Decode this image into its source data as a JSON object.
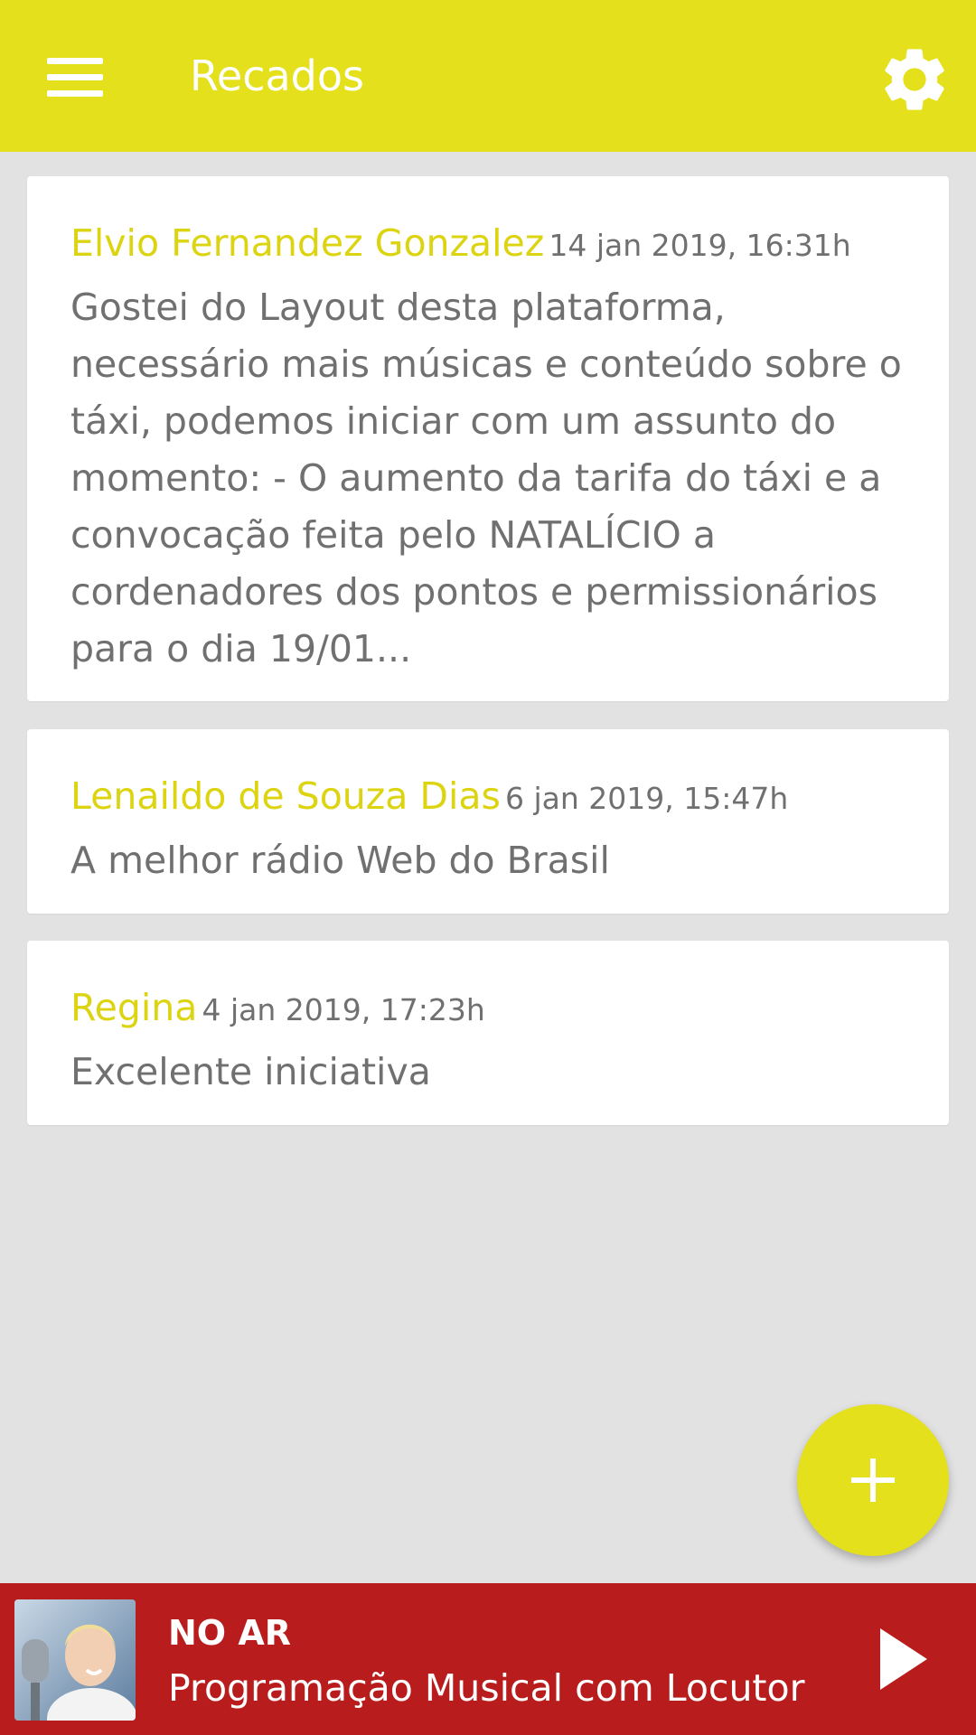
{
  "appbar": {
    "title": "Recados",
    "menu_icon": "menu-icon",
    "settings_icon": "gear-icon",
    "background": "#e4e01b"
  },
  "messages": [
    {
      "author": "Elvio Fernandez Gonzalez",
      "date": "14 jan 2019, 16:31h",
      "text": "Gostei do Layout desta plataforma, necessário mais músicas e conteúdo sobre o táxi, podemos iniciar com um assunto do momento: - O aumento da tarifa do táxi e a convocação feita pelo NATALÍCIO a cordenadores dos pontos e permissionários para o dia 19/01..."
    },
    {
      "author": "Lenaildo de Souza Dias",
      "date": "6 jan 2019, 15:47h",
      "text": "A melhor rádio Web do Brasil"
    },
    {
      "author": "Regina",
      "date": "4 jan 2019, 17:23h",
      "text": "Excelente iniciativa"
    }
  ],
  "fab": {
    "icon": "plus-icon"
  },
  "player": {
    "label": "NO AR",
    "program": "Programação Musical com Locutor ...",
    "play_icon": "play-icon",
    "background": "#b91c1c"
  },
  "colors": {
    "accent": "#e4e01b",
    "author": "#dcd410",
    "text": "#707070",
    "page_background": "#e2e2e2"
  }
}
